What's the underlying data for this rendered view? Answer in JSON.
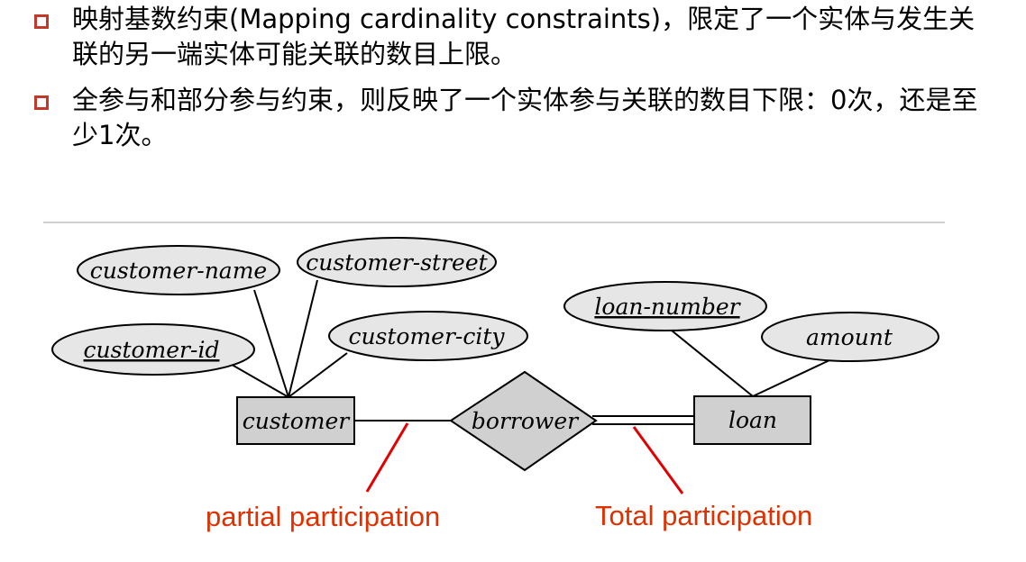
{
  "bullets": [
    "映射基数约束(Mapping cardinality constraints)，限定了一个实体与发生关联的另一端实体可能关联的数目上限。",
    "全参与和部分参与约束，则反映了一个实体参与关联的数目下限：0次，还是至少1次。"
  ],
  "diagram": {
    "attributes": {
      "customer_name": "customer-name",
      "customer_street": "customer-street",
      "customer_id": "customer-id",
      "customer_city": "customer-city",
      "loan_number": "loan-number",
      "amount": "amount"
    },
    "entities": {
      "customer": "customer",
      "loan": "loan"
    },
    "relationship": "borrower",
    "annotations": {
      "partial": "partial participation",
      "total": "Total participation"
    },
    "colors": {
      "attribute_fill": "#e6e6e6",
      "entity_fill": "#d0d0d0",
      "annotation": "#e03000",
      "bullet": "#c0392b"
    }
  }
}
